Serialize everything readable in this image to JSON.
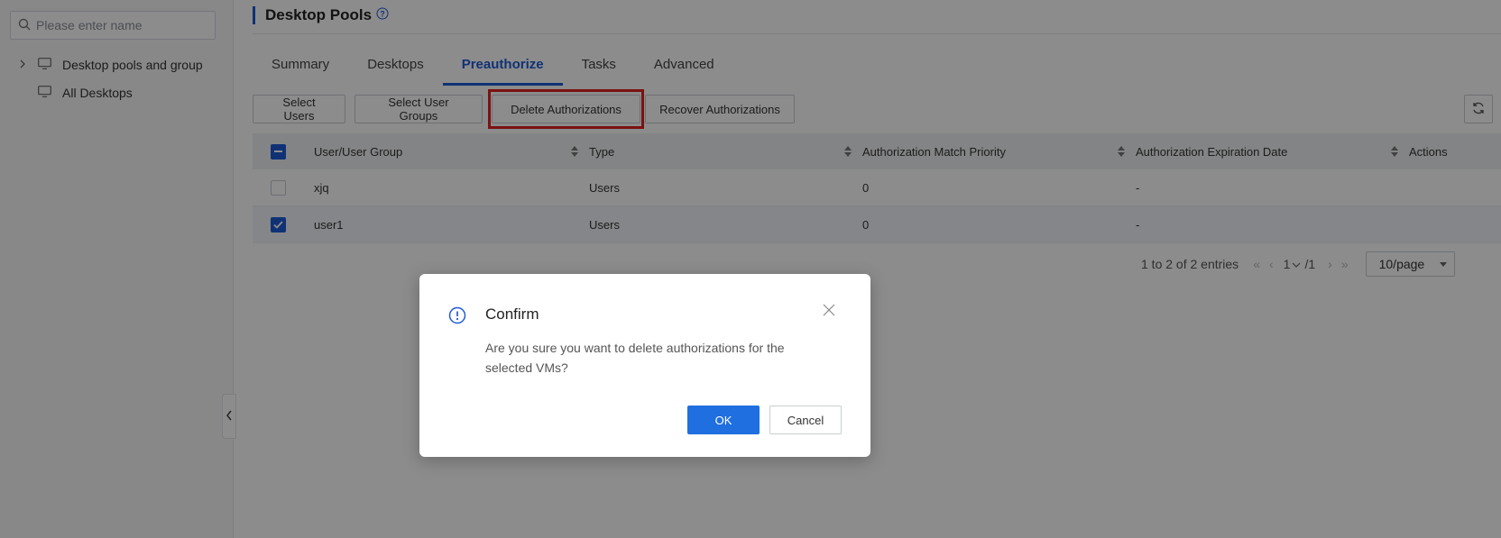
{
  "sidebar": {
    "search_placeholder": "Please enter name",
    "tree": [
      {
        "label": "Desktop pools and group",
        "icon": "monitor-icon",
        "expandable": true
      },
      {
        "label": "All Desktops",
        "icon": "monitor-icon",
        "expandable": false
      }
    ]
  },
  "header": {
    "title": "Desktop Pools",
    "help_icon": "question-circle-icon"
  },
  "tabs": [
    {
      "label": "Summary",
      "active": false
    },
    {
      "label": "Desktops",
      "active": false
    },
    {
      "label": "Preauthorize",
      "active": true
    },
    {
      "label": "Tasks",
      "active": false
    },
    {
      "label": "Advanced",
      "active": false
    }
  ],
  "toolbar": {
    "select_users": "Select Users",
    "select_user_groups": "Select User Groups",
    "delete_authorizations": "Delete Authorizations",
    "recover_authorizations": "Recover Authorizations",
    "refresh_icon": "refresh-icon"
  },
  "table": {
    "columns": [
      "User/User Group",
      "Type",
      "Authorization Match Priority",
      "Authorization Expiration Date",
      "Actions"
    ],
    "rows": [
      {
        "user": "xjq",
        "type": "Users",
        "priority": "0",
        "expiration": "-",
        "checked": false
      },
      {
        "user": "user1",
        "type": "Users",
        "priority": "0",
        "expiration": "-",
        "checked": true
      }
    ],
    "header_checkbox": "indeterminate"
  },
  "pagination": {
    "summary": "1 to 2 of 2 entries",
    "current_page": "1",
    "total_pages": "/1",
    "page_size": "10/page"
  },
  "dialog": {
    "title": "Confirm",
    "message": "Are you sure you want to delete authorizations for the selected VMs?",
    "ok_label": "OK",
    "cancel_label": "Cancel",
    "icon": "info-circle-icon"
  },
  "colors": {
    "accent": "#1e5bd6",
    "primary_button": "#1f6fe0",
    "highlight": "#e02020"
  }
}
